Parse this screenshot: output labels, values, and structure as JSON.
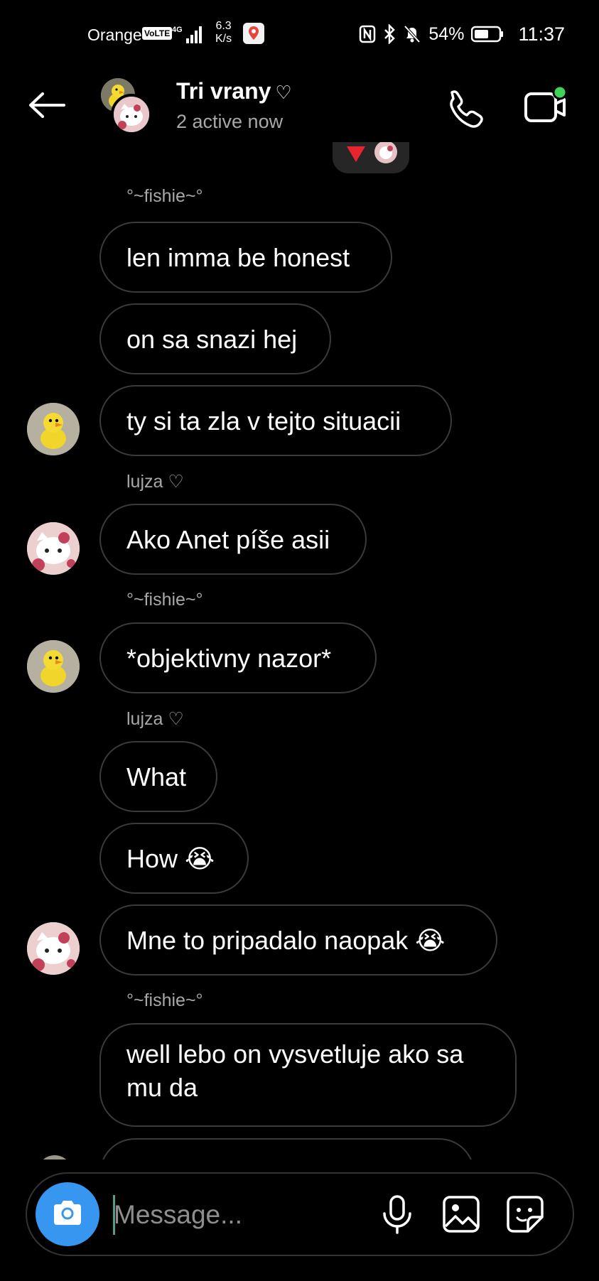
{
  "status_bar": {
    "carrier": "Orange",
    "volte": "VoLTE",
    "network": "4G",
    "speed_value": "6.3",
    "speed_unit": "K/s",
    "battery_pct": "54%",
    "time": "11:37"
  },
  "header": {
    "title": "Tri vrany",
    "title_heart": "♡",
    "status": "2 active now",
    "video_online_color": "#3ed35b"
  },
  "messages": [
    {
      "sender": "°~fishie~°"
    },
    {
      "text": "len imma be honest"
    },
    {
      "text": "on sa snazi hej"
    },
    {
      "text": "ty si ta zla v tejto situacii"
    },
    {
      "sender": "lujza ♡"
    },
    {
      "text": "Ako Anet píše asii"
    },
    {
      "sender": "°~fishie~°"
    },
    {
      "text": "*objektivny nazor*"
    },
    {
      "sender": "lujza ♡"
    },
    {
      "text": "What"
    },
    {
      "text": "How 😭"
    },
    {
      "text": "Mne to pripadalo naopak 😭"
    },
    {
      "sender": "°~fishie~°"
    },
    {
      "text_line1": "well lebo on vysvetluje ako sa",
      "text_line2": "mu da"
    }
  ],
  "composer": {
    "placeholder": "Message..."
  },
  "colors": {
    "accent": "#3797f0",
    "bubble_border": "#3a3a3a",
    "secondary_text": "#a8a8a8"
  },
  "icons": {
    "back": "arrow-left-icon",
    "call": "phone-icon",
    "video": "video-camera-icon",
    "camera": "camera-icon",
    "mic": "microphone-icon",
    "gallery": "image-icon",
    "sticker": "sticker-icon"
  }
}
